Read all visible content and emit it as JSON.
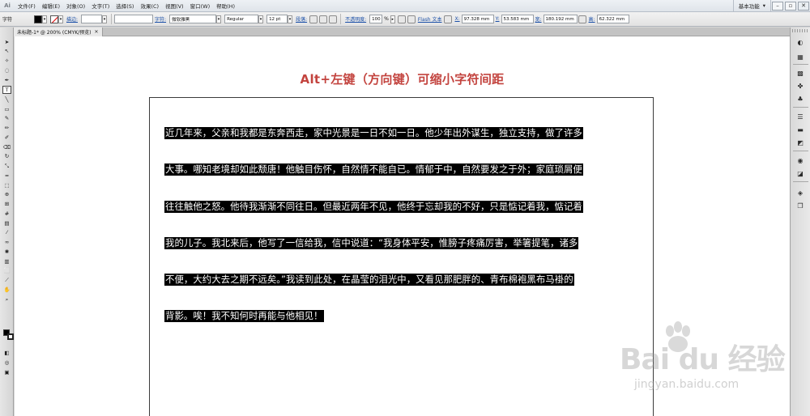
{
  "menubar": {
    "logo": "Ai",
    "items": [
      "文件(F)",
      "编辑(E)",
      "对象(O)",
      "文字(T)",
      "选择(S)",
      "效果(C)",
      "视图(V)",
      "窗口(W)",
      "帮助(H)"
    ],
    "workspace": "基本功能",
    "window_buttons": [
      "–",
      "▫",
      "✕"
    ]
  },
  "controlbar": {
    "panel_label": "字符",
    "stroke_label": "描边:",
    "char_link": "字符:",
    "font_family": "微软雅黑",
    "font_style": "Regular",
    "font_size": "12 pt",
    "paragraph_link": "段落:",
    "opacity_link": "不透明度:",
    "opacity_value": "100",
    "opacity_unit": "%",
    "flash_link": "Flash 文本",
    "x_label": "X:",
    "x_value": "97.328 mm",
    "y_label": "Y:",
    "y_value": "53.583 mm",
    "w_label": "宽:",
    "w_value": "180.192 mm",
    "h_label": "高:",
    "h_value": "62.322 mm"
  },
  "document": {
    "tab_label": "未标题-1* @ 200% (CMYK/预览)",
    "close": "✕"
  },
  "canvas": {
    "title": "Alt+左键（方向键）可缩小字符间距",
    "lines": [
      "近几年来，父亲和我都是东奔西走，家中光景是一日不如一日。他少年出外谋生，独立支持，做了许多",
      "大事。哪知老境却如此颓唐！他触目伤怀，自然情不能自已。情郁于中，自然要发之于外；家庭琐屑便",
      "往往触他之怒。他待我渐渐不同往日。但最近两年不见，他终于忘却我的不好，只是惦记着我，惦记着",
      "我的儿子。我北来后，他写了一信给我，信中说道：“我身体平安，惟膀子疼痛厉害，举箸提笔，诸多",
      "不便，大约大去之期不远矣。”我读到此处，在晶莹的泪光中，又看见那肥胖的、青布棉袍黑布马褂的",
      "背影。唉！我不知何时再能与他相见！"
    ]
  },
  "watermark": {
    "brand": "Bai du",
    "cn": "经验",
    "site": "jingyan.baidu.com"
  },
  "colors": {
    "title": "#c3443f",
    "highlight": "#000000",
    "text": "#ffffff"
  }
}
